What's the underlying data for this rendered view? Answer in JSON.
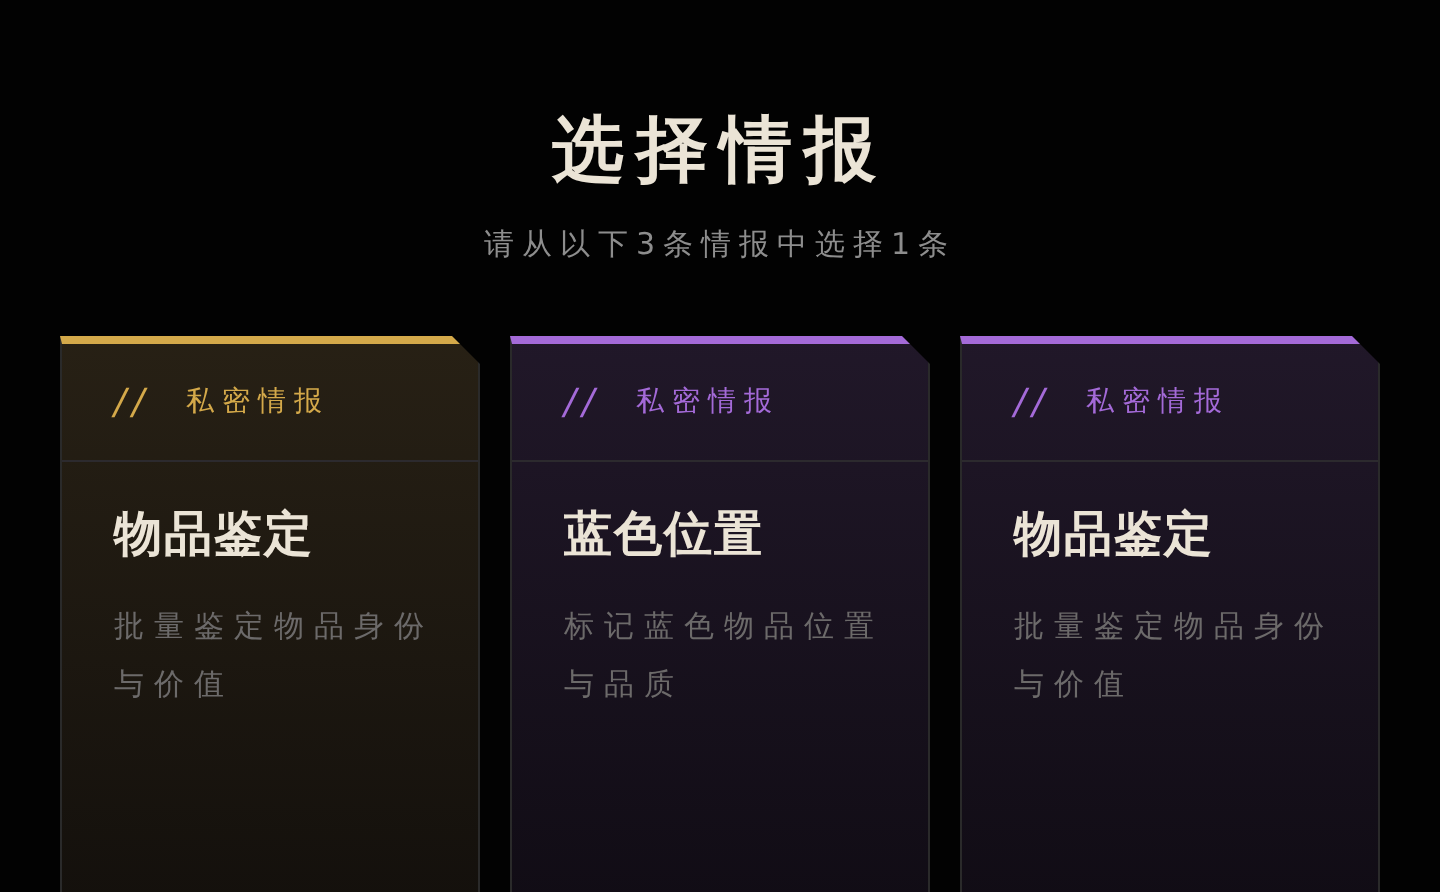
{
  "title": "选择情报",
  "subtitle": "请从以下3条情报中选择1条",
  "cards": [
    {
      "mark": "//",
      "tag": "私密情报",
      "name": "物品鉴定",
      "description": "批量鉴定物品身份与价值",
      "color": "#d4a94a"
    },
    {
      "mark": "//",
      "tag": "私密情报",
      "name": "蓝色位置",
      "description": "标记蓝色物品位置与品质",
      "color": "#a46ad8"
    },
    {
      "mark": "//",
      "tag": "私密情报",
      "name": "物品鉴定",
      "description": "批量鉴定物品身份与价值",
      "color": "#a46ad8"
    }
  ]
}
